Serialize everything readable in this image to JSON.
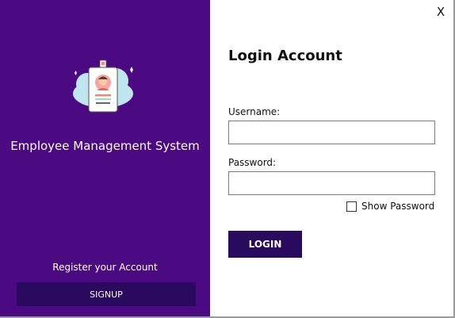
{
  "window": {
    "close_label": "X"
  },
  "left_panel": {
    "app_title": "Employee Management System",
    "register_text": "Register your Account",
    "signup_label": "SIGNUP",
    "logo_icon": "employee-id-badge-icon",
    "background_color": "#4b0a82"
  },
  "login_form": {
    "title": "Login Account",
    "username_label": "Username:",
    "username_value": "",
    "password_label": "Password:",
    "password_value": "",
    "show_password_label": "Show Password",
    "show_password_checked": false,
    "login_label": "LOGIN",
    "button_color": "#2a0a5e"
  }
}
